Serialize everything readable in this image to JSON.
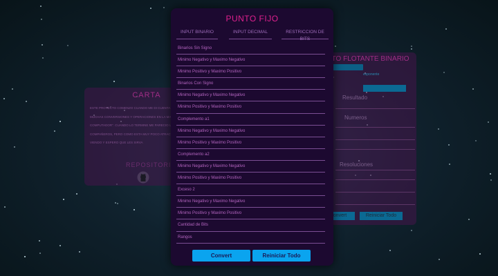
{
  "left_card": {
    "title": "CARTA",
    "paragraph": "ESTE PROYECTO COMENZO CUANDO ME DI CUENTA QUE SE PODRIAN AUTOMATIZAR MUCHAS CONVERSIONES Y OPERACIONES EN LA MATERIA \"ORGANIZACION DEL COMPUTADOR\". CUANDO LO TERMINE ME PARECIO UTIL DE COMPARTIRLO CON MIS COMPAÑEROS, PERO COMO ESTA MUY POCO ATRACTIVA LA WEB FINAL ES LO QUE ESTAN VIENDO Y ESPERO QUE LES SIRVA",
    "repo_label": "REPOSITORIO",
    "repo_icon": "github-icon"
  },
  "right_card": {
    "title": "PUNTO FLOTANTE BINARIO",
    "hint": "exponente",
    "result_label": "Resultado",
    "numbers_label": "Numeros",
    "resolutions_label": "Resoluciones",
    "convert_label": "Convert",
    "reset_label": "Reiniciar Todo"
  },
  "main_card": {
    "title": "PUNTO FIJO",
    "tabs": [
      {
        "label": "INPUT BINARIO"
      },
      {
        "label": "INPUT DECIMAL"
      },
      {
        "label": "RESTRICCION DE BITS"
      }
    ],
    "rows": [
      {
        "label": "Binarios Sin Signo"
      },
      {
        "label": "Minimo Negativo y Maximo Negativo"
      },
      {
        "label": "Minimo Positivo y Maximo Positivo"
      },
      {
        "label": "Binarios Con Signo"
      },
      {
        "label": "Minimo Negativo y Maximo Negativo"
      },
      {
        "label": "Minimo Positivo y Maximo Positivo"
      },
      {
        "label": "Complemento a1"
      },
      {
        "label": "Minimo Negativo y Maximo Negativo"
      },
      {
        "label": "Minimo Positivo y Maximo Positivo"
      },
      {
        "label": "Complemento a2"
      },
      {
        "label": "Minimo Negativo y Maximo Negativo"
      },
      {
        "label": "Minimo Positivo y Maximo Positivo"
      },
      {
        "label": "Exceso 2"
      },
      {
        "label": "Minimo Negativo y Maximo Negativo"
      },
      {
        "label": "Minimo Positivo y Maximo Positivo"
      },
      {
        "label": "Cantidad de Bits"
      },
      {
        "label": "Rangos"
      }
    ],
    "convert_label": "Convert",
    "reset_label": "Reiniciar Todo"
  },
  "colors": {
    "accent_pink": "#e0208f",
    "button_blue": "#0aa4ef",
    "card_bg": "#1c0930"
  }
}
